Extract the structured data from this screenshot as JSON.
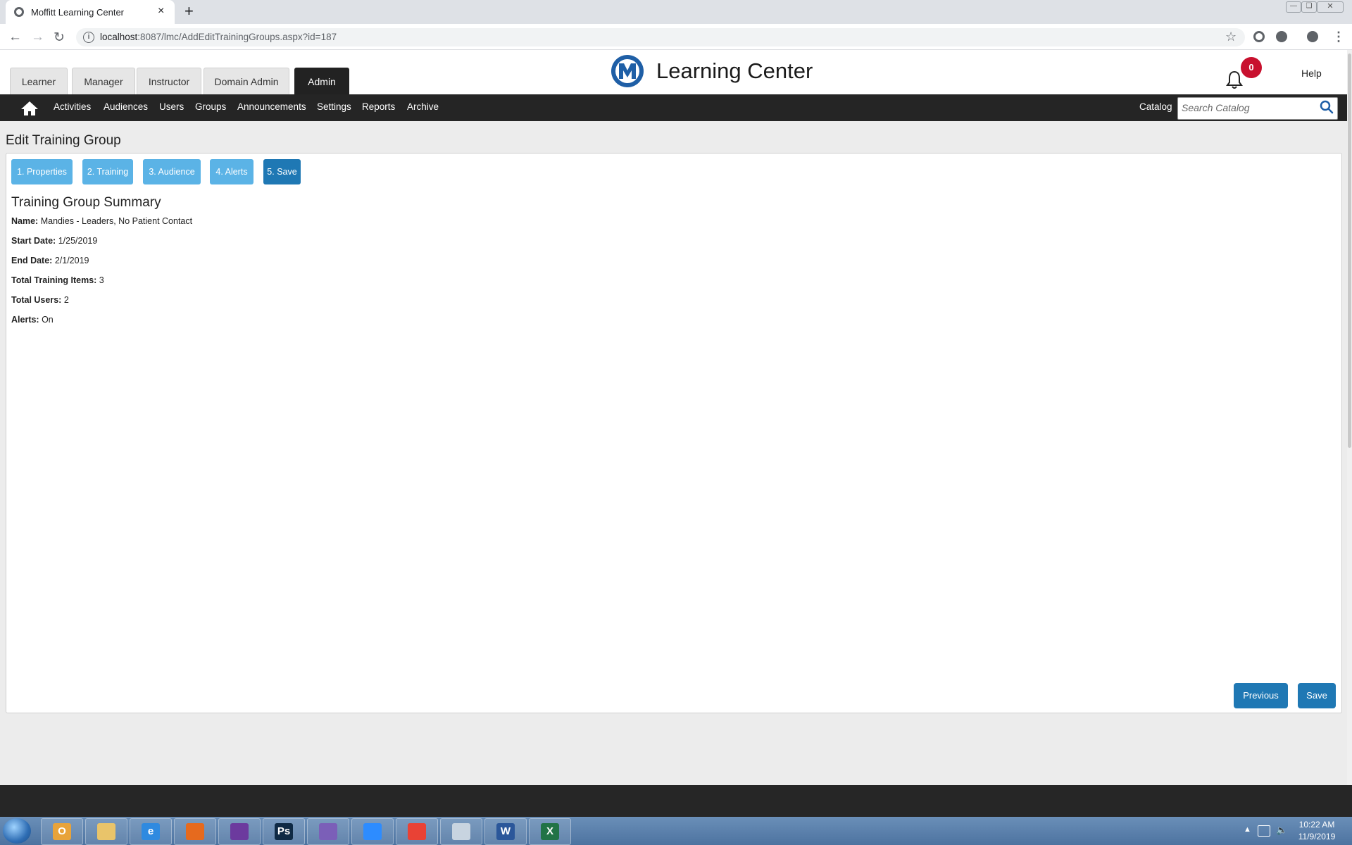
{
  "browser": {
    "tab_title": "Moffitt Learning Center",
    "tab_close": "×",
    "new_tab": "+",
    "url_host": "localhost",
    "url_rest": ":8087/lmc/AddEditTrainingGroups.aspx?id=187"
  },
  "header": {
    "role_tabs": [
      {
        "label": "Learner"
      },
      {
        "label": "Manager"
      },
      {
        "label": "Instructor"
      },
      {
        "label": "Domain Admin"
      },
      {
        "label": "Admin"
      }
    ],
    "active_role": "Admin",
    "app_title": "Learning Center",
    "notification_count": "0",
    "help_label": "Help"
  },
  "nav": {
    "items": [
      {
        "label": "Activities"
      },
      {
        "label": "Audiences"
      },
      {
        "label": "Users"
      },
      {
        "label": "Groups"
      },
      {
        "label": "Announcements"
      },
      {
        "label": "Settings"
      },
      {
        "label": "Reports"
      },
      {
        "label": "Archive"
      }
    ],
    "catalog_label": "Catalog",
    "search_placeholder": "Search Catalog"
  },
  "page": {
    "title": "Edit Training Group",
    "steps": [
      {
        "label": "1. Properties"
      },
      {
        "label": "2. Training"
      },
      {
        "label": "3. Audience"
      },
      {
        "label": "4. Alerts"
      },
      {
        "label": "5. Save"
      }
    ],
    "active_step": "5. Save",
    "summary_heading": "Training Group Summary",
    "fields": [
      {
        "label": "Name:",
        "value": "Mandies - Leaders, No Patient Contact"
      },
      {
        "label": "Start Date:",
        "value": "1/25/2019"
      },
      {
        "label": "End Date:",
        "value": "2/1/2019"
      },
      {
        "label": "Total Training Items:",
        "value": "3"
      },
      {
        "label": "Total Users:",
        "value": "2"
      },
      {
        "label": "Alerts:",
        "value": "On"
      }
    ],
    "previous_label": "Previous",
    "save_label": "Save"
  },
  "taskbar": {
    "clock_time": "10:22 AM",
    "clock_date": "11/9/2019",
    "apps": [
      {
        "icon": "outlook-icon",
        "color": "#e8a33a",
        "glyph": "O"
      },
      {
        "icon": "file-explorer-icon",
        "color": "#e9c46a",
        "glyph": ""
      },
      {
        "icon": "internet-explorer-icon",
        "color": "#2f8ae0",
        "glyph": "e"
      },
      {
        "icon": "firefox-icon",
        "color": "#e66a1e",
        "glyph": ""
      },
      {
        "icon": "visual-studio-icon",
        "color": "#6c3a9e",
        "glyph": ""
      },
      {
        "icon": "photoshop-icon",
        "color": "#0f2a45",
        "glyph": "Ps"
      },
      {
        "icon": "visual-studio-purple-icon",
        "color": "#7b5fb8",
        "glyph": ""
      },
      {
        "icon": "zoom-icon",
        "color": "#2d8cff",
        "glyph": ""
      },
      {
        "icon": "chrome-icon",
        "color": "#e94235",
        "glyph": ""
      },
      {
        "icon": "snipping-tool-icon",
        "color": "#c8d4e0",
        "glyph": ""
      },
      {
        "icon": "word-icon",
        "color": "#2b579a",
        "glyph": "W"
      },
      {
        "icon": "excel-icon",
        "color": "#217346",
        "glyph": "X"
      }
    ]
  }
}
